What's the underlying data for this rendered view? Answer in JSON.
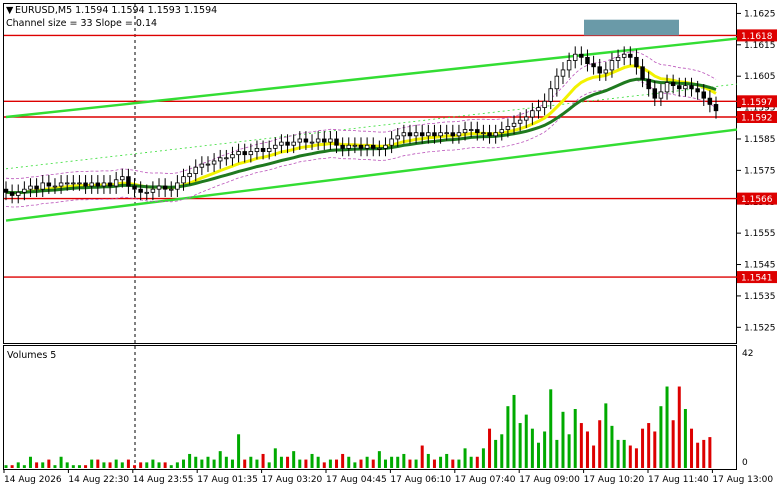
{
  "header": {
    "symbol_line": "EURUSD,M5  1.1594 1.1594 1.1593 1.1594",
    "channel_line": "Channel size = 33 Slope = 0.14"
  },
  "volumes_panel": {
    "title": "Volumes 5",
    "axis_max_label": "42",
    "axis_min_label": "0",
    "volume_max": 42
  },
  "colors": {
    "up_candle": "#00aa00",
    "down_candle": "#dd0000",
    "channel_line": "#33dd33",
    "level_line": "#dd0000",
    "ma_fast": "#f2f200",
    "ma_slow": "#1f7a1f",
    "envelope": "#bb55bb",
    "price_tag_bg": "#dd0000",
    "resistance_zone": "#6a9aa8"
  },
  "chart_data": {
    "type": "candlestick",
    "ylim": [
      1.152,
      1.1628
    ],
    "y_ticks": [
      "1.1625",
      "1.1615",
      "1.1605",
      "1.1595",
      "1.1585",
      "1.1575",
      "1.1565",
      "1.1555",
      "1.1545",
      "1.1535",
      "1.1525"
    ],
    "x_ticks": [
      "14 Aug 2026",
      "14 Aug 22:30",
      "14 Aug 23:55",
      "17 Aug 01:35",
      "17 Aug 03:20",
      "17 Aug 04:45",
      "17 Aug 06:10",
      "17 Aug 07:40",
      "17 Aug 09:00",
      "17 Aug 10:20",
      "17 Aug 11:40",
      "17 Aug 13:00"
    ],
    "levels": [
      {
        "label": "1.1618",
        "price": 1.1618
      },
      {
        "label": "1.1597",
        "price": 1.1597
      },
      {
        "label": "1.1592",
        "price": 1.1592
      },
      {
        "label": "1.1566",
        "price": 1.1566
      },
      {
        "label": "1.1541",
        "price": 1.1541
      }
    ],
    "channel_upper": [
      [
        0,
        1.1592
      ],
      [
        112,
        1.1617
      ]
    ],
    "channel_lower": [
      [
        0,
        1.1559
      ],
      [
        112,
        1.1588
      ]
    ],
    "closes": [
      1.1568,
      1.1567,
      1.1568,
      1.1569,
      1.157,
      1.1569,
      1.1571,
      1.157,
      1.157,
      1.1571,
      1.1571,
      1.1571,
      1.1571,
      1.157,
      1.1571,
      1.157,
      1.1571,
      1.157,
      1.1572,
      1.1573,
      1.157,
      1.1569,
      1.1568,
      1.1568,
      1.1569,
      1.157,
      1.1569,
      1.1569,
      1.1571,
      1.1573,
      1.1574,
      1.1576,
      1.1577,
      1.1577,
      1.1578,
      1.1579,
      1.1579,
      1.158,
      1.1581,
      1.158,
      1.1581,
      1.1582,
      1.1581,
      1.1582,
      1.1583,
      1.1584,
      1.1583,
      1.1584,
      1.1585,
      1.1584,
      1.1584,
      1.1585,
      1.1584,
      1.1585,
      1.1583,
      1.1582,
      1.1583,
      1.1583,
      1.1582,
      1.1583,
      1.1582,
      1.1582,
      1.1583,
      1.1585,
      1.1586,
      1.1587,
      1.1586,
      1.1587,
      1.1586,
      1.1587,
      1.1586,
      1.1587,
      1.1587,
      1.1586,
      1.1587,
      1.1588,
      1.1588,
      1.1587,
      1.1587,
      1.1586,
      1.1587,
      1.1588,
      1.1589,
      1.159,
      1.1591,
      1.1592,
      1.1594,
      1.1595,
      1.1597,
      1.1601,
      1.1605,
      1.1607,
      1.161,
      1.1612,
      1.1611,
      1.1609,
      1.1608,
      1.1606,
      1.1607,
      1.161,
      1.1611,
      1.1612,
      1.1611,
      1.1608,
      1.1604,
      1.1601,
      1.1598,
      1.16,
      1.1603,
      1.1602,
      1.1601,
      1.1602,
      1.1601,
      1.16,
      1.1598,
      1.1596,
      1.1594
    ],
    "volumes": [
      1,
      1,
      2,
      1,
      4,
      2,
      2,
      3,
      1,
      4,
      2,
      1,
      1,
      1,
      3,
      3,
      2,
      2,
      3,
      2,
      3,
      1,
      2,
      2,
      3,
      2,
      2,
      1,
      2,
      3,
      5,
      4,
      3,
      4,
      3,
      6,
      4,
      3,
      12,
      3,
      4,
      3,
      5,
      2,
      7,
      4,
      4,
      6,
      3,
      3,
      5,
      4,
      2,
      3,
      3,
      5,
      4,
      2,
      3,
      4,
      3,
      6,
      3,
      4,
      4,
      5,
      3,
      3,
      8,
      5,
      3,
      4,
      5,
      3,
      3,
      7,
      4,
      4,
      7,
      14,
      10,
      12,
      22,
      26,
      16,
      19,
      14,
      9,
      13,
      28,
      10,
      20,
      12,
      21,
      16,
      13,
      8,
      17,
      23,
      15,
      10,
      10,
      8,
      7,
      14,
      16,
      13,
      22,
      29,
      17,
      29,
      21,
      14,
      9,
      10,
      11
    ]
  }
}
